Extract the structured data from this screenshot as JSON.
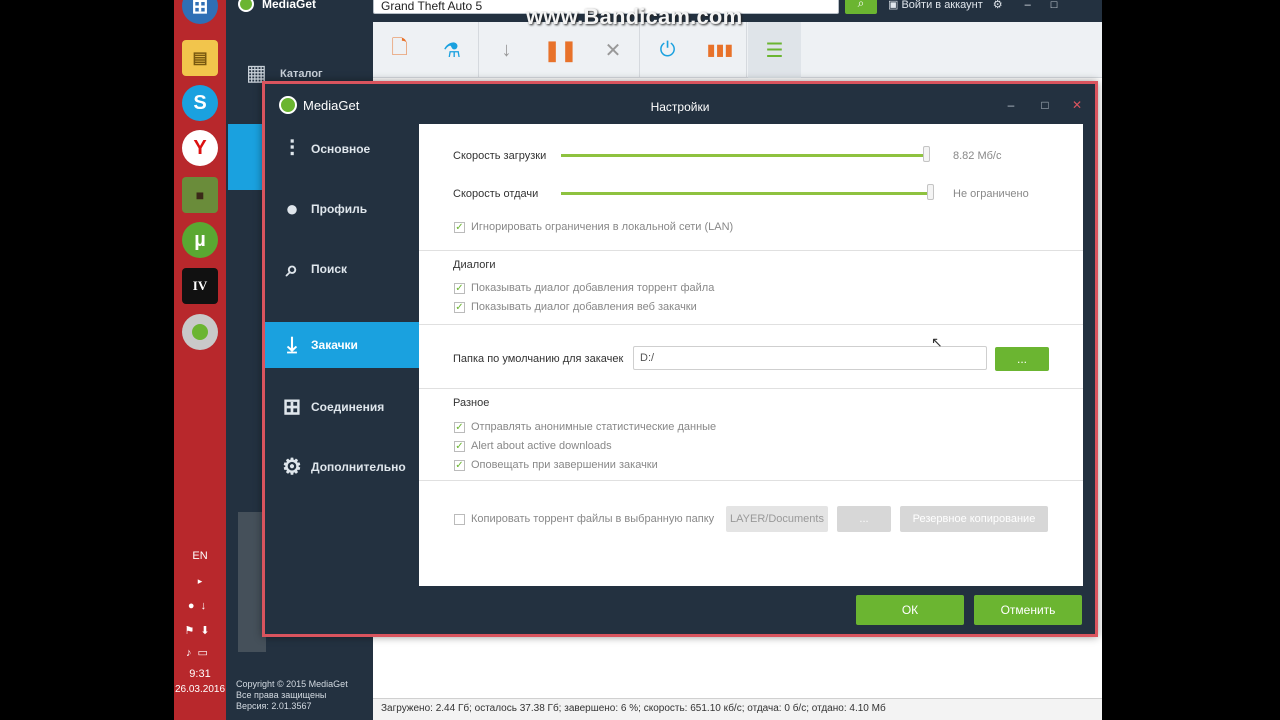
{
  "watermark": "www.Bandicam.com",
  "taskbar": {
    "lang": "EN",
    "time": "9:31",
    "date": "26.03.2016"
  },
  "main": {
    "app_name": "MediaGet",
    "search_value": "Grand Theft Auto 5",
    "login_label": "Войти в аккаунт",
    "sidebar_catalog": "Каталог",
    "copyright": "Copyright © 2015 MediaGet",
    "rights": "Все права защищены",
    "version": "Версия: 2.01.3567",
    "status_bar": "Загружено: 2.44 Гб; осталось 37.38 Гб; завершено: 6 %; скорость: 651.10 кб/с; отдача: 0 б/с; отдано: 4.10 Мб"
  },
  "dialog": {
    "app_name": "MediaGet",
    "title": "Настройки",
    "nav": [
      {
        "label": "Основное"
      },
      {
        "label": "Профиль"
      },
      {
        "label": "Поиск"
      },
      {
        "label": "Закачки"
      },
      {
        "label": "Соединения"
      },
      {
        "label": "Дополнительно"
      }
    ],
    "speed": {
      "download_label": "Скорость загрузки",
      "download_value": "8.82 Мб/с",
      "download_fill": 0.99,
      "upload_label": "Скорость отдачи",
      "upload_value": "Не ограничено",
      "upload_fill": 1.0,
      "ignore_lan": "Игнорировать ограничения в локальной сети (LAN)"
    },
    "dialogs": {
      "heading": "Диалоги",
      "show_torrent": "Показывать диалог добавления торрент файла",
      "show_web": "Показывать диалог добавления веб закачки"
    },
    "folder": {
      "label": "Папка по умолчанию для закачек",
      "value": "D:/",
      "browse": "..."
    },
    "misc": {
      "heading": "Разное",
      "anon_stats": "Отправлять анонимные статистические данные",
      "alert_active": "Alert about active downloads",
      "notify_done": "Оповещать при завершении закачки"
    },
    "copy": {
      "label": "Копировать торрент файлы в выбранную папку",
      "path": "LAYER/Documents",
      "browse": "...",
      "backup": "Резервное копирование"
    },
    "ok": "ОК",
    "cancel": "Отменить"
  }
}
